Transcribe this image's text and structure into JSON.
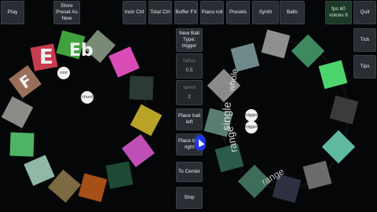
{
  "toolbar": {
    "play": "Play",
    "store_preset": "Store Preset As New",
    "instr_ctrl": "Instr Ctrl",
    "total_ctrl": "Total Ctrl",
    "buffer_fx": "Buffer FX",
    "piano_roll": "Piano roll",
    "presets": "Presets",
    "synth": "Synth",
    "balls": "Balls",
    "fps": "fps 60 voices 8",
    "quit": "Quit"
  },
  "side_panel": {
    "tick": "Tick",
    "tips": "Tips"
  },
  "center_panel": {
    "new_ball_type": "New Ball Type: trigger",
    "radius_label": "radius",
    "radius_value": "0.5",
    "speed_label": "speed",
    "speed_value": "2",
    "place_left": "Place ball left",
    "place_right": "Place ball right",
    "to_center": "To Center",
    "stop": "Stop"
  },
  "left_wheel": {
    "notes": [
      "E",
      "Eb",
      "F"
    ],
    "balls": [
      "root",
      "chord"
    ],
    "colors": [
      "#41a23d",
      "#7a8a76",
      "#d94cb8",
      "#2c3a35",
      "#b8a326",
      "#c04fb5",
      "#1e4a35",
      "#a64f16",
      "#7b6a42",
      "#8fb8a6",
      "#4fb366",
      "#8d8b87",
      "#9a6f5a",
      "#c93b50"
    ]
  },
  "right_wheel": {
    "labels": [
      "whole",
      "single",
      "range",
      "range"
    ],
    "balls": [
      "trigger",
      "trigger"
    ],
    "colors": [
      "#8e9090",
      "#3e8a5e",
      "#4ed46c",
      "#3b3b3b",
      "#5fb9a0",
      "#6b6b6b",
      "#2c3040",
      "#3e6e5a",
      "#2b5b4a",
      "#5a7e74",
      "#8a8a8a",
      "#6f8a8a"
    ]
  }
}
